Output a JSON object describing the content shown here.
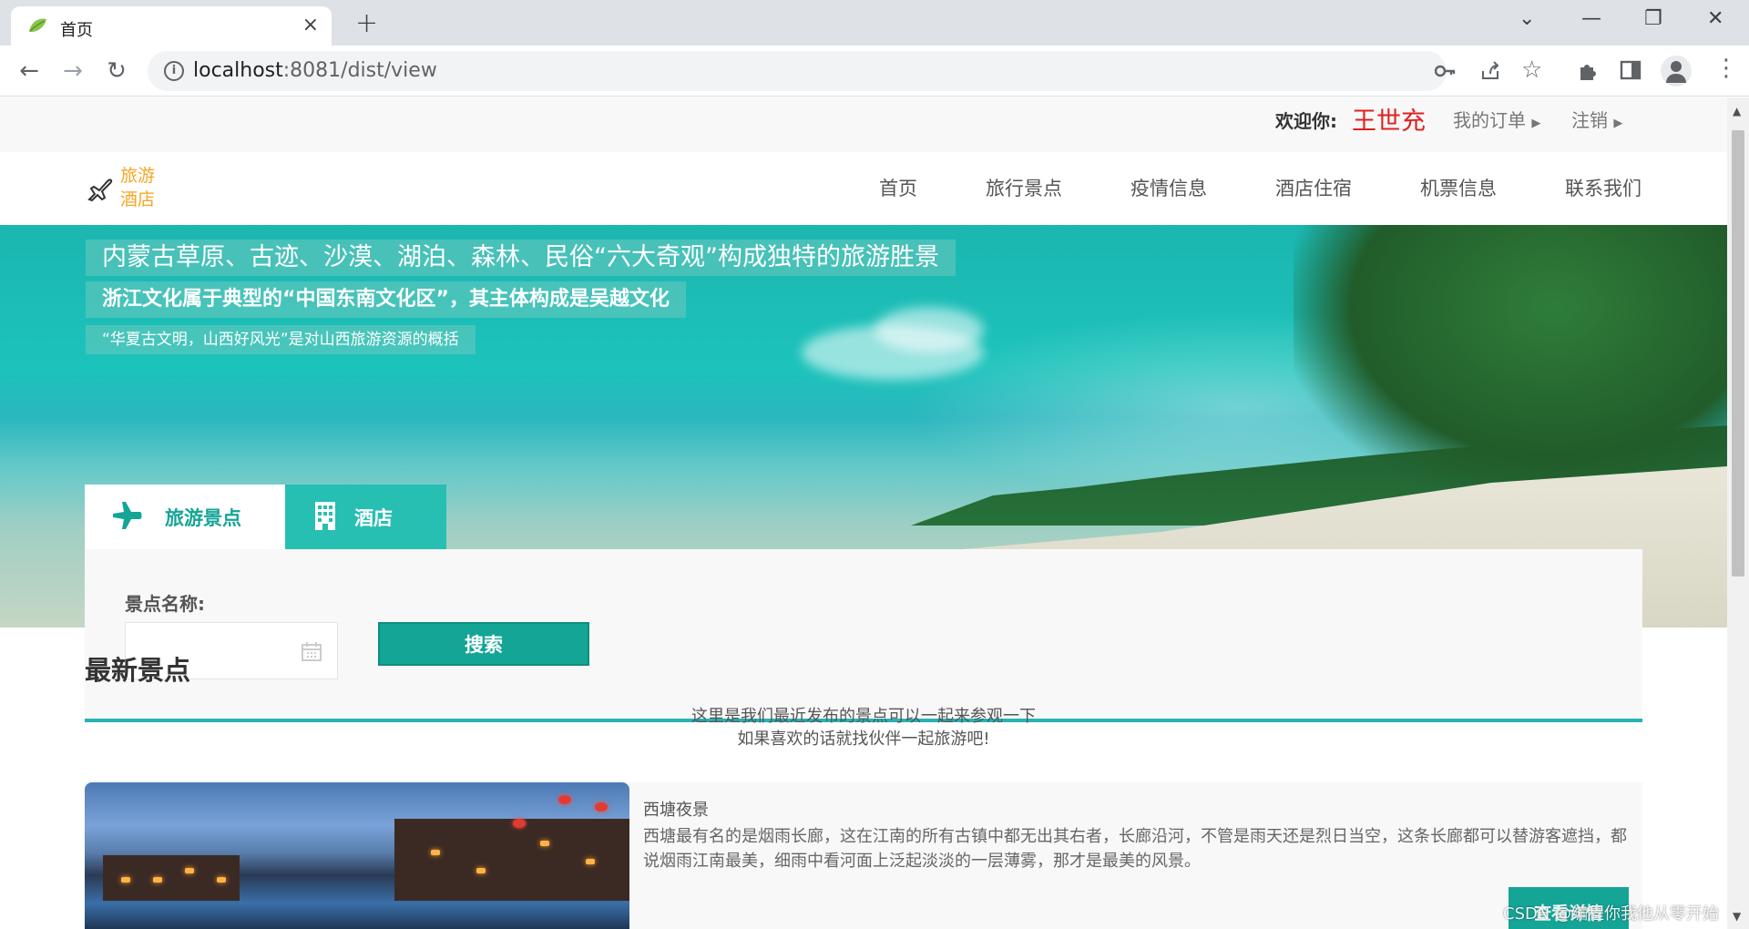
{
  "browser": {
    "tab_title": "首页",
    "tab_close": "×",
    "new_tab": "+",
    "url_host": "localhost",
    "url_rest": ":8081/dist/view",
    "controls": {
      "dropdown": "⌄",
      "minimize": "—",
      "restore": "❐",
      "close": "✕"
    }
  },
  "topbar": {
    "welcome_label": "欢迎你:",
    "username": "王世充",
    "my_orders": "我的订单",
    "logout": "注销"
  },
  "header": {
    "logo_line1": "旅游",
    "logo_line2": "酒店",
    "nav": [
      "首页",
      "旅行景点",
      "疫情信息",
      "酒店住宿",
      "机票信息",
      "联系我们"
    ]
  },
  "hero": {
    "line1": "内蒙古草原、古迹、沙漠、湖泊、森林、民俗“六大奇观”构成独特的旅游胜景",
    "line2": "浙江文化属于典型的“中国东南文化区”，其主体构成是吴越文化",
    "line3": "“华夏古文明，山西好风光”是对山西旅游资源的概括"
  },
  "search": {
    "tab_spots": "旅游景点",
    "tab_hotel": "酒店",
    "field_label": "景点名称:",
    "field_value": "",
    "button": "搜索"
  },
  "latest": {
    "title": "最新景点",
    "subtitle_line1": "这里是我们最近发布的景点可以一起来参观一下",
    "subtitle_line2": "如果喜欢的话就找伙伴一起旅游吧!",
    "cards": [
      {
        "title": "西塘夜景",
        "description": "西塘最有名的是烟雨长廊，这在江南的所有古镇中都无出其右者，长廊沿河，不管是雨天还是烈日当空，这条长廊都可以替游客遮挡，都说烟雨江南最美，细雨中看河面上泛起淡淡的一层薄雾，那才是最美的风景。",
        "button": "查看详情"
      }
    ]
  },
  "watermark": "CSDN @编程你我他从零开始",
  "colors": {
    "accent": "#14a596",
    "tab_accent": "#27bfb2",
    "username": "#e02020",
    "logo": "#f6a623"
  },
  "icons": [
    "leaf-favicon-icon",
    "back-icon",
    "forward-icon",
    "reload-icon",
    "info-icon",
    "key-icon",
    "share-icon",
    "star-icon",
    "extensions-icon",
    "sidepanel-icon",
    "profile-icon",
    "menu-icon",
    "plane-icon",
    "building-icon",
    "calendar-icon",
    "caret-right-icon"
  ]
}
